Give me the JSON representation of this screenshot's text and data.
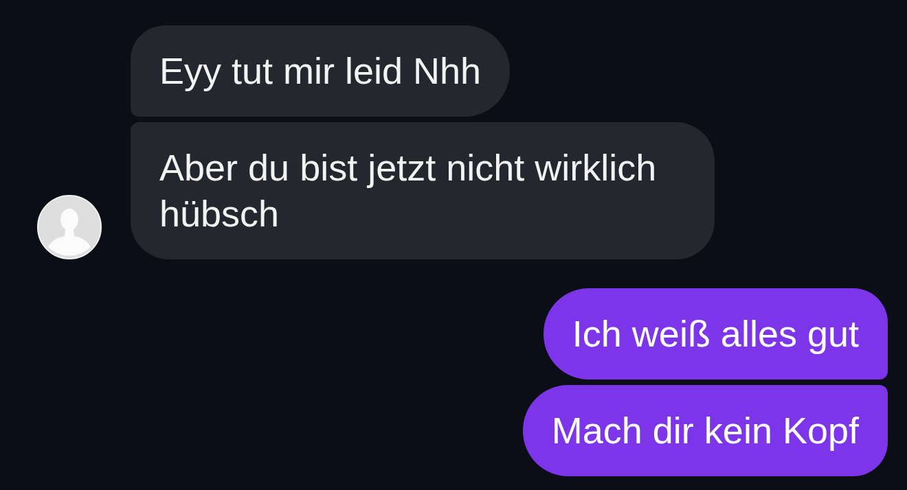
{
  "conversation": {
    "groups": [
      {
        "kind": "incoming",
        "messages": [
          {
            "text": "Eyy tut mir leid Nhh"
          },
          {
            "text": "Aber du bist jetzt nicht wirklich hübsch"
          }
        ]
      },
      {
        "kind": "outgoing",
        "messages": [
          {
            "text": "Ich weiß alles gut"
          },
          {
            "text": "Mach dir kein Kopf"
          }
        ]
      }
    ]
  }
}
